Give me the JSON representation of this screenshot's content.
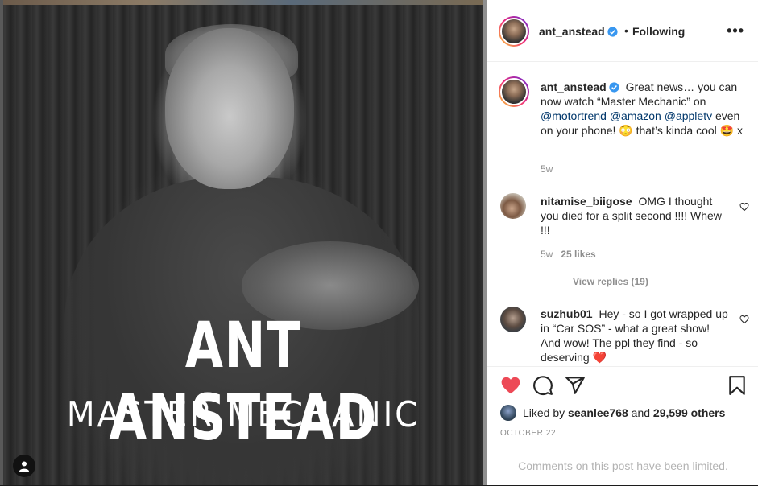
{
  "photo": {
    "title": "ANT ANSTEAD",
    "subtitle": "MASTER MECHANIC",
    "tag_icon": "user-icon"
  },
  "header": {
    "username": "ant_anstead",
    "separator": "•",
    "follow_status": "Following",
    "more_icon": "•••"
  },
  "caption": {
    "username": "ant_anstead",
    "text_1": "Great news… you can now watch “Master Mechanic” on",
    "mention_1": "@motortrend",
    "mention_2": "@amazon",
    "mention_3": "@appletv",
    "text_2": "even on your phone! 😳 that’s kinda cool 🤩 x",
    "age": "5w"
  },
  "comments": [
    {
      "username": "nitamise_biigose",
      "text": "OMG I thought you died for a split second !!!! Whew !!!",
      "age": "5w",
      "likes": "25 likes",
      "view_replies": "View replies (19)"
    },
    {
      "username": "suzhub01",
      "text": "Hey - so I got wrapped up in “Car SOS” - what a great show! And wow! The ppl they find - so deserving ❤️"
    }
  ],
  "likes": {
    "prefix": "Liked by",
    "user": "seanlee768",
    "joiner": "and",
    "others": "29,599 others"
  },
  "date": "OCTOBER 22",
  "comments_limited": "Comments on this post have been limited.",
  "colors": {
    "like_red": "#ed4956",
    "verified_blue": "#3897f0",
    "mention_blue": "#00376b"
  }
}
